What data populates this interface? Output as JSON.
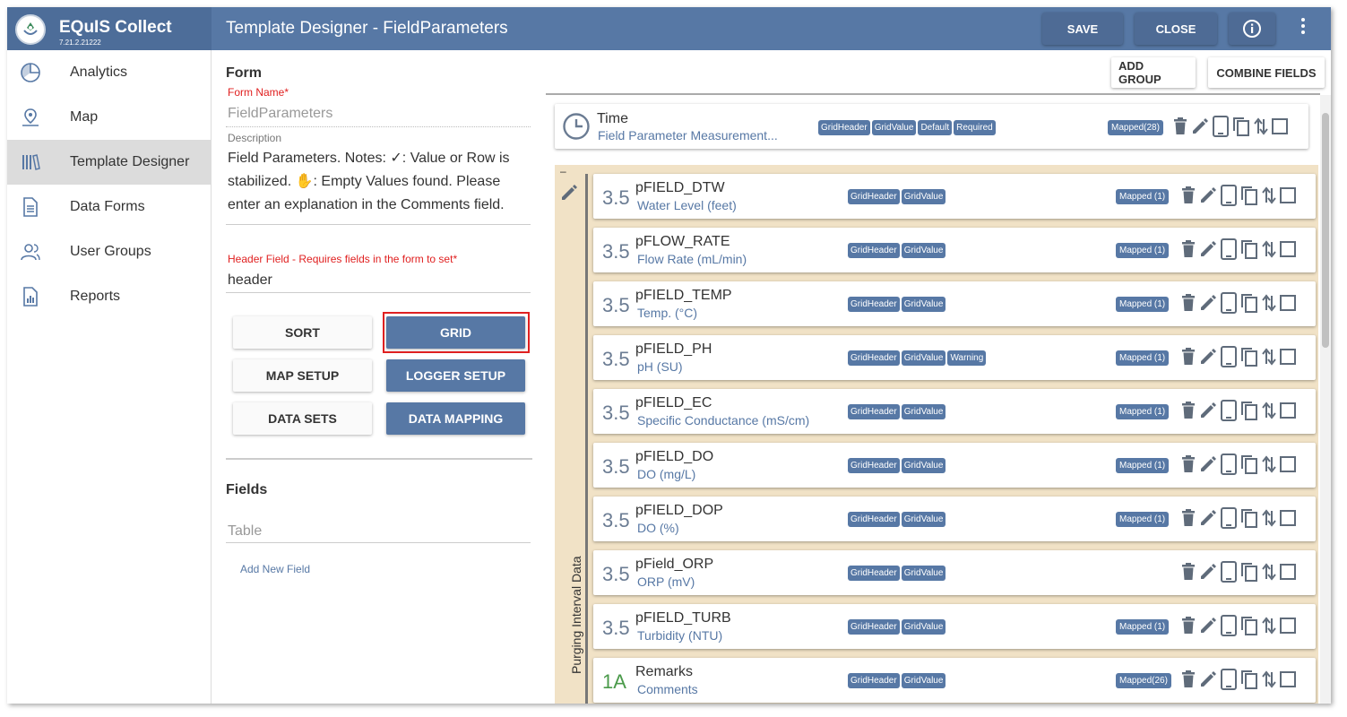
{
  "app": {
    "name": "EQuIS Collect",
    "version": "7.21.2.21222"
  },
  "header": {
    "title": "Template Designer - FieldParameters",
    "save_label": "SAVE",
    "close_label": "CLOSE",
    "info_icon": "info-icon",
    "more_icon": "more-vert-icon"
  },
  "sidebar": {
    "items": [
      {
        "label": "Analytics",
        "icon": "pie-chart-icon"
      },
      {
        "label": "Map",
        "icon": "map-pin-icon"
      },
      {
        "label": "Template Designer",
        "icon": "library-books-icon",
        "active": true
      },
      {
        "label": "Data Forms",
        "icon": "document-icon"
      },
      {
        "label": "User Groups",
        "icon": "users-icon"
      },
      {
        "label": "Reports",
        "icon": "report-chart-icon"
      }
    ]
  },
  "form": {
    "section_title": "Form",
    "form_name_label": "Form Name",
    "required_mark": "*",
    "form_name_value": "FieldParameters",
    "description_label": "Description",
    "description_line1": "Field Parameters. Notes: ✓: Value or Row is",
    "description_line2": "stabilized. ✋: Empty Values found. Please",
    "description_line3": "enter an explanation in the Comments field.",
    "header_field_label": "Header Field - Requires fields in the form to set",
    "header_field_value": "header",
    "buttons": {
      "sort": "SORT",
      "grid": "GRID",
      "map_setup": "MAP SETUP",
      "logger_setup": "LOGGER SETUP",
      "data_sets": "DATA SETS",
      "data_mapping": "DATA MAPPING"
    },
    "fields_title": "Fields",
    "fields_placeholder": "Table",
    "add_new_field": "Add New Field"
  },
  "canvas": {
    "add_group": "ADD GROUP",
    "combine_fields": "COMBINE FIELDS",
    "time_field": {
      "name": "Time",
      "desc": "Field Parameter Measurement...",
      "tags": [
        "GridHeader",
        "GridValue",
        "Default",
        "Required"
      ],
      "mapped": "Mapped(28)",
      "icon": "clock-icon"
    },
    "group": {
      "label": "Purging Interval Data",
      "collapse": "–"
    },
    "fields": [
      {
        "num": "3.5",
        "name": "pFIELD_DTW",
        "desc": "Water Level (feet)",
        "tags": [
          "GridHeader",
          "GridValue"
        ],
        "mapped": "Mapped (1)"
      },
      {
        "num": "3.5",
        "name": "pFLOW_RATE",
        "desc": "Flow Rate (mL/min)",
        "tags": [
          "GridHeader",
          "GridValue"
        ],
        "mapped": "Mapped (1)"
      },
      {
        "num": "3.5",
        "name": "pFIELD_TEMP",
        "desc": "Temp. (°C)",
        "tags": [
          "GridHeader",
          "GridValue"
        ],
        "mapped": "Mapped (1)"
      },
      {
        "num": "3.5",
        "name": "pFIELD_PH",
        "desc": "pH (SU)",
        "tags": [
          "GridHeader",
          "GridValue",
          "Warning"
        ],
        "mapped": "Mapped (1)"
      },
      {
        "num": "3.5",
        "name": "pFIELD_EC",
        "desc": "Specific Conductance (mS/cm)",
        "tags": [
          "GridHeader",
          "GridValue"
        ],
        "mapped": "Mapped (1)"
      },
      {
        "num": "3.5",
        "name": "pFIELD_DO",
        "desc": "DO (mg/L)",
        "tags": [
          "GridHeader",
          "GridValue"
        ],
        "mapped": "Mapped (1)"
      },
      {
        "num": "3.5",
        "name": "pFIELD_DOP",
        "desc": "DO (%)",
        "tags": [
          "GridHeader",
          "GridValue"
        ],
        "mapped": "Mapped (1)"
      },
      {
        "num": "3.5",
        "name": "pField_ORP",
        "desc": "ORP (mV)",
        "tags": [
          "GridHeader",
          "GridValue"
        ],
        "mapped": ""
      },
      {
        "num": "3.5",
        "name": "pFIELD_TURB",
        "desc": "Turbidity (NTU)",
        "tags": [
          "GridHeader",
          "GridValue"
        ],
        "mapped": "Mapped (1)"
      },
      {
        "num": "1A",
        "name": "Remarks",
        "desc": "Comments",
        "tags": [
          "GridHeader",
          "GridValue"
        ],
        "mapped": "Mapped(26)"
      }
    ]
  },
  "colors": {
    "brand": "#5778a5",
    "brand_dark": "#4e6b95",
    "group_bg": "#f1e2c6",
    "highlight": "#e02020"
  }
}
